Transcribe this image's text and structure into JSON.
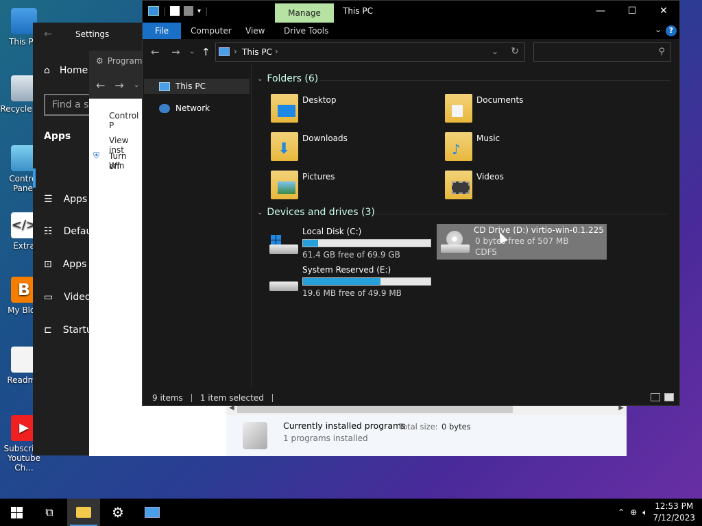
{
  "desktop": {
    "icons": [
      {
        "label": "This PC"
      },
      {
        "label": "Recycle Bin"
      },
      {
        "label": "Control Panel"
      },
      {
        "label": "Extra"
      },
      {
        "label": "My Blog"
      },
      {
        "label": "Readme"
      },
      {
        "label": "Subscribe Youtube Ch..."
      }
    ]
  },
  "settings": {
    "title": "Settings",
    "back_icon": "arrow-left-icon",
    "home": "Home",
    "find_placeholder": "Find a se",
    "section": "Apps",
    "nav": [
      "Apps",
      "Defau",
      "Apps",
      "Video",
      "Startu"
    ]
  },
  "programs": {
    "title": "Programs",
    "side_links": [
      "Control P",
      "View inst",
      "Turn Win",
      "off"
    ],
    "summary_title": "Currently installed programs",
    "total_size_label": "Total size:",
    "total_size_value": "0 bytes",
    "count": "1 programs installed"
  },
  "explorer": {
    "manage_tab": "Manage",
    "window_title": "This PC",
    "ribbon_tabs": [
      "File",
      "Computer",
      "View",
      "Drive Tools"
    ],
    "address": "This PC",
    "nav_items": [
      "This PC",
      "Network"
    ],
    "folders_header": "Folders (6)",
    "folders": [
      "Desktop",
      "Documents",
      "Downloads",
      "Music",
      "Pictures",
      "Videos"
    ],
    "devices_header": "Devices and drives (3)",
    "drives": [
      {
        "name": "Local Disk (C:)",
        "free": "61.4 GB free of 69.9 GB",
        "used_fraction": 0.12
      },
      {
        "name": "System Reserved (E:)",
        "free": "19.6 MB free of 49.9 MB",
        "used_fraction": 0.61
      }
    ],
    "cd_drive": {
      "name": "CD Drive (D:) virtio-win-0.1.225",
      "free": "0 bytes free of 507 MB",
      "fs": "CDFS"
    },
    "status_items": "9 items",
    "status_selected": "1 item selected"
  },
  "taskbar": {
    "time": "12:53 PM",
    "date": "7/12/2023"
  }
}
